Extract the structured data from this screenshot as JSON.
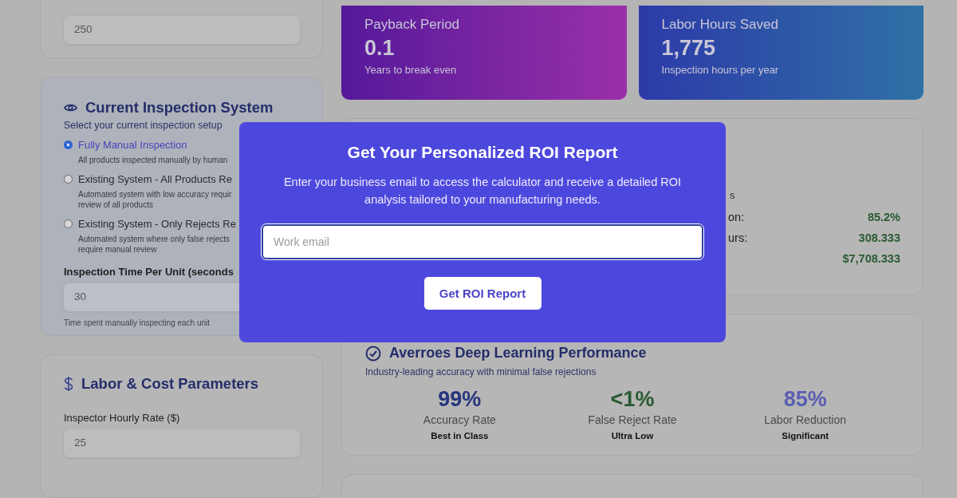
{
  "working_days": {
    "value": "250"
  },
  "inspection_system": {
    "title": "Current Inspection System",
    "subtitle": "Select your current inspection setup",
    "options": [
      {
        "label": "Fully Manual Inspection",
        "description_lines": [
          "All products inspected manually by human"
        ],
        "selected": true
      },
      {
        "label": "Existing System - All Products Re",
        "description_lines": [
          "Automated system with low accuracy requir",
          "review of all products"
        ],
        "selected": false
      },
      {
        "label": "Existing System - Only Rejects Re",
        "description_lines": [
          "Automated system where only false rejects",
          "require manual review"
        ],
        "selected": false
      }
    ],
    "time_field": {
      "label": "Inspection Time Per Unit (seconds",
      "value": "30",
      "hint": "Time spent manually inspecting each unit"
    }
  },
  "labor_cost": {
    "title": "Labor & Cost Parameters",
    "field": {
      "label": "Inspector Hourly Rate ($)",
      "value": "25"
    }
  },
  "stat_cards": [
    {
      "kind": "violet",
      "title": "Payback Period",
      "value": "0.1",
      "caption": "Years to break even"
    },
    {
      "kind": "blue",
      "title": "Labor Hours Saved",
      "value": "1,775",
      "caption": "Inspection hours per year"
    }
  ],
  "results": {
    "heading_fragment": "s",
    "rows": [
      {
        "label": "on:",
        "value": "85.2%"
      },
      {
        "label": "urs:",
        "value": "308.333"
      },
      {
        "label": "",
        "value": "$7,708.333"
      }
    ]
  },
  "performance": {
    "title": "Averroes Deep Learning Performance",
    "subtitle": "Industry-leading accuracy with minimal false rejections",
    "metrics": [
      {
        "value": "99%",
        "label": "Accuracy Rate",
        "note": "Best in Class",
        "color": "#27357e"
      },
      {
        "value": "<1%",
        "label": "False Reject Rate",
        "note": "Ultra Low",
        "color": "#2a5a32"
      },
      {
        "value": "85%",
        "label": "Labor Reduction",
        "note": "Significant",
        "color": "#5a5fb0"
      }
    ]
  },
  "modal": {
    "title": "Get Your Personalized ROI Report",
    "text": "Enter your business email to access the calculator and receive a detailed ROI analysis tailored to your manufacturing needs.",
    "email_field": {
      "placeholder": "Work email"
    },
    "button": "Get ROI Report"
  }
}
